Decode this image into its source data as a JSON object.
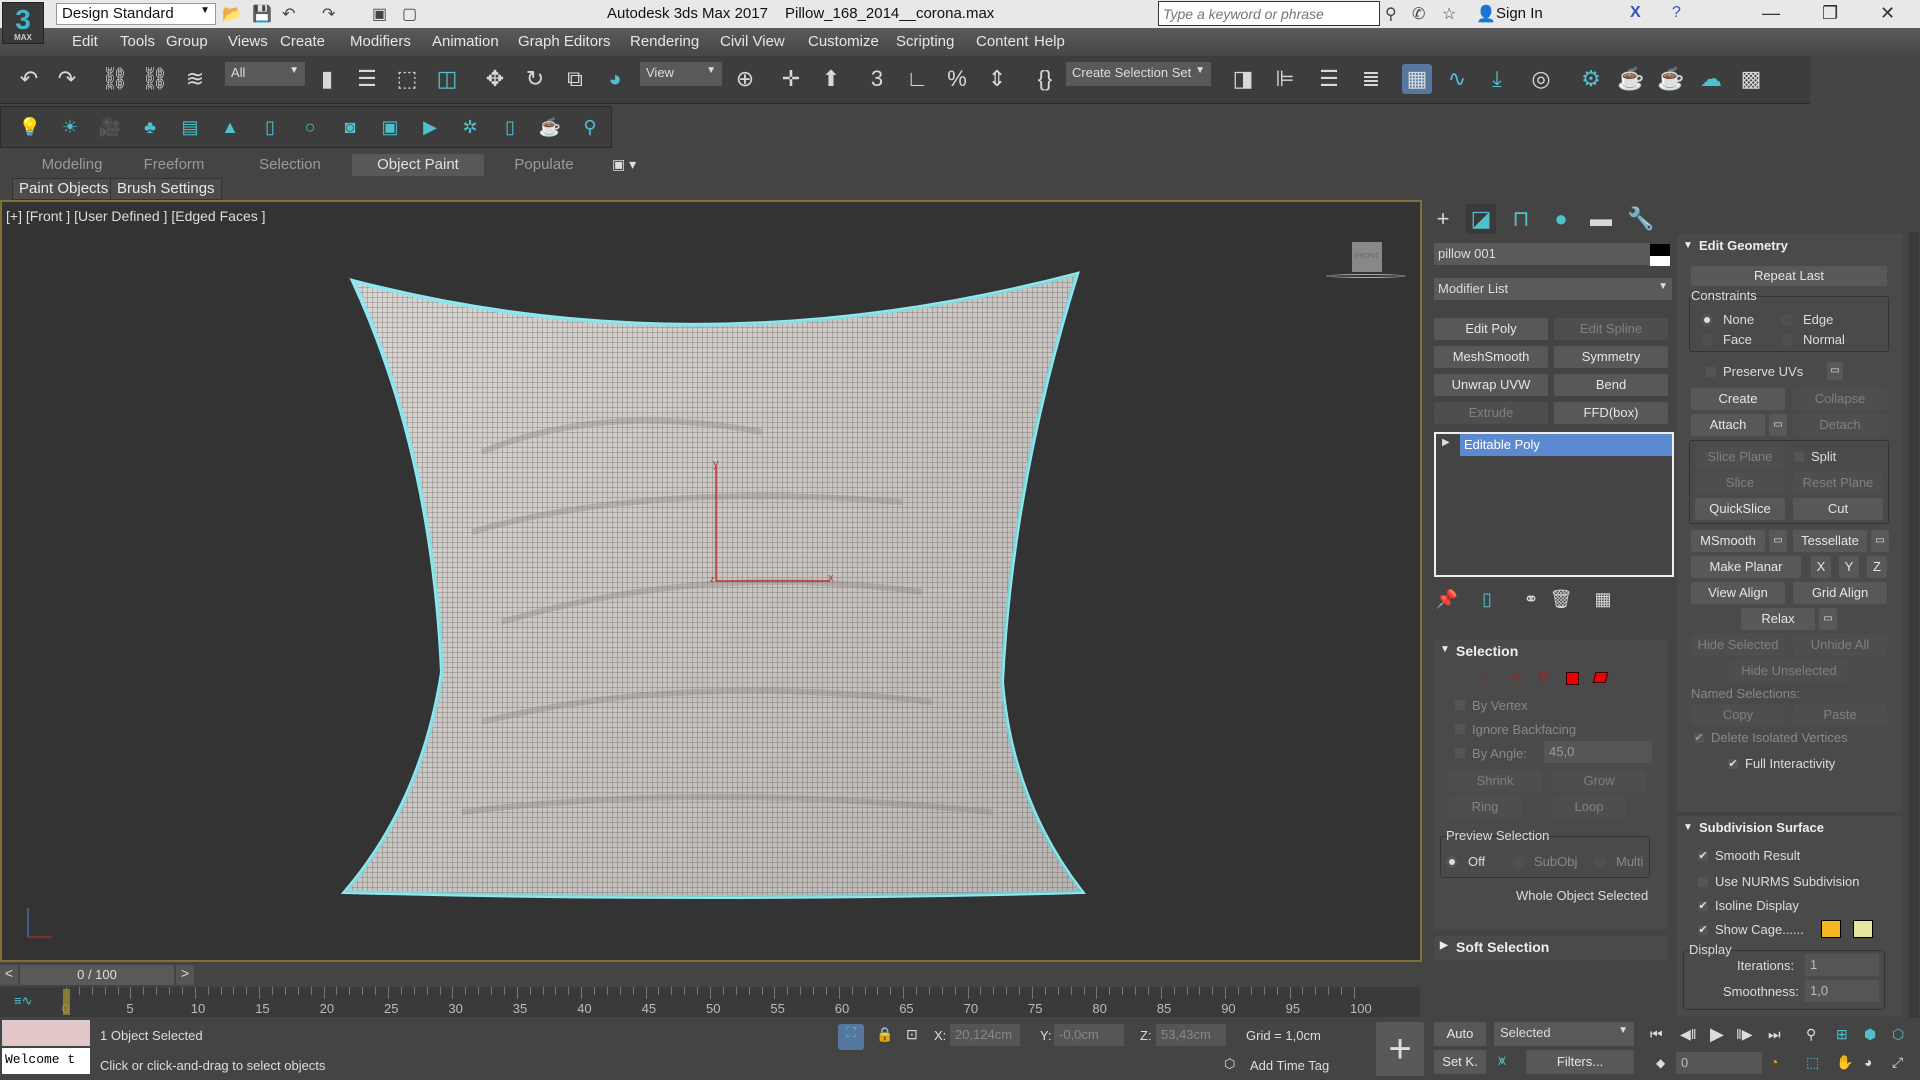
{
  "titlebar": {
    "workspace": "Design Standard",
    "app": "Autodesk 3ds Max 2017",
    "file": "Pillow_168_2014__corona.max",
    "search_placeholder": "Type a keyword or phrase",
    "sign_in": "Sign In",
    "logo": "3",
    "logo_sub": "MAX"
  },
  "menu": [
    "Edit",
    "Tools",
    "Group",
    "Views",
    "Create",
    "Modifiers",
    "Animation",
    "Graph Editors",
    "Rendering",
    "Civil View",
    "Customize",
    "Scripting",
    "Content",
    "Help"
  ],
  "toolbar": {
    "filter": "All",
    "ref_coord": "View",
    "selection_set": "Create Selection Set"
  },
  "ribbon": {
    "tabs": [
      "Modeling",
      "Freeform",
      "Selection",
      "Object Paint",
      "Populate"
    ],
    "active": "Object Paint",
    "subtabs": [
      "Paint Objects",
      "Brush Settings"
    ]
  },
  "viewport": {
    "label": "[+] [Front ] [User Defined ] [Edged Faces ]",
    "viewcube": "FRONT",
    "axis": {
      "x": "x",
      "y": "y",
      "z": "z"
    }
  },
  "command_panel": {
    "object_name": "pillow 001",
    "object_color": "#000000",
    "modifier_list": "Modifier List",
    "modifier_buttons": [
      {
        "label": "Edit Poly",
        "enabled": true
      },
      {
        "label": "Edit Spline",
        "enabled": false
      },
      {
        "label": "MeshSmooth",
        "enabled": true
      },
      {
        "label": "Symmetry",
        "enabled": true
      },
      {
        "label": "Unwrap UVW",
        "enabled": true
      },
      {
        "label": "Bend",
        "enabled": true
      },
      {
        "label": "Extrude",
        "enabled": false
      },
      {
        "label": "FFD(box)",
        "enabled": true
      }
    ],
    "stack": [
      "Editable Poly"
    ],
    "selection": {
      "title": "Selection",
      "by_vertex": "By Vertex",
      "ignore_backfacing": "Ignore Backfacing",
      "by_angle": "By Angle:",
      "angle_value": "45,0",
      "shrink": "Shrink",
      "grow": "Grow",
      "ring": "Ring",
      "loop": "Loop",
      "preview_title": "Preview Selection",
      "preview_options": [
        "Off",
        "SubObj",
        "Multi"
      ],
      "status": "Whole Object Selected"
    },
    "soft_selection": "Soft Selection"
  },
  "edit_geometry": {
    "title": "Edit Geometry",
    "repeat_last": "Repeat Last",
    "constraints": "Constraints",
    "constraint_options": [
      "None",
      "Edge",
      "Face",
      "Normal"
    ],
    "preserve_uvs": "Preserve UVs",
    "create": "Create",
    "collapse": "Collapse",
    "attach": "Attach",
    "detach": "Detach",
    "slice_plane": "Slice Plane",
    "split": "Split",
    "slice": "Slice",
    "reset_plane": "Reset Plane",
    "quickslice": "QuickSlice",
    "cut": "Cut",
    "msmooth": "MSmooth",
    "tessellate": "Tessellate",
    "make_planar": "Make Planar",
    "x": "X",
    "y": "Y",
    "z": "Z",
    "view_align": "View Align",
    "grid_align": "Grid Align",
    "relax": "Relax",
    "hide_selected": "Hide Selected",
    "unhide_all": "Unhide All",
    "hide_unselected": "Hide Unselected",
    "named_selections": "Named Selections:",
    "copy": "Copy",
    "paste": "Paste",
    "delete_isolated": "Delete Isolated Vertices",
    "full_interactivity": "Full Interactivity"
  },
  "subdivision": {
    "title": "Subdivision Surface",
    "smooth_result": "Smooth Result",
    "use_nurms": "Use NURMS Subdivision",
    "isoline": "Isoline Display",
    "show_cage": "Show Cage......",
    "cage_colors": [
      "#f5b820",
      "#e8e4a0"
    ],
    "display": "Display",
    "iterations_label": "Iterations:",
    "iterations": "1",
    "smoothness_label": "Smoothness:",
    "smoothness": "1,0"
  },
  "timeline": {
    "frame": "0 / 100",
    "ticks": [
      "0",
      "5",
      "10",
      "15",
      "20",
      "25",
      "30",
      "35",
      "40",
      "45",
      "50",
      "55",
      "60",
      "65",
      "70",
      "75",
      "80",
      "85",
      "90",
      "95",
      "100"
    ]
  },
  "status": {
    "selected": "1 Object Selected",
    "prompt": "Click or click-and-drag to select objects",
    "maxscript": "Welcome t",
    "x_label": "X:",
    "x": "20,124cm",
    "y_label": "Y:",
    "y": "-0,0cm",
    "z_label": "Z:",
    "z": "53,43cm",
    "grid": "Grid = 1,0cm",
    "add_time_tag": "Add Time Tag",
    "auto": "Auto",
    "set_key": "Set K.",
    "key_mode": "Selected",
    "filters": "Filters...",
    "current_frame": "0"
  }
}
